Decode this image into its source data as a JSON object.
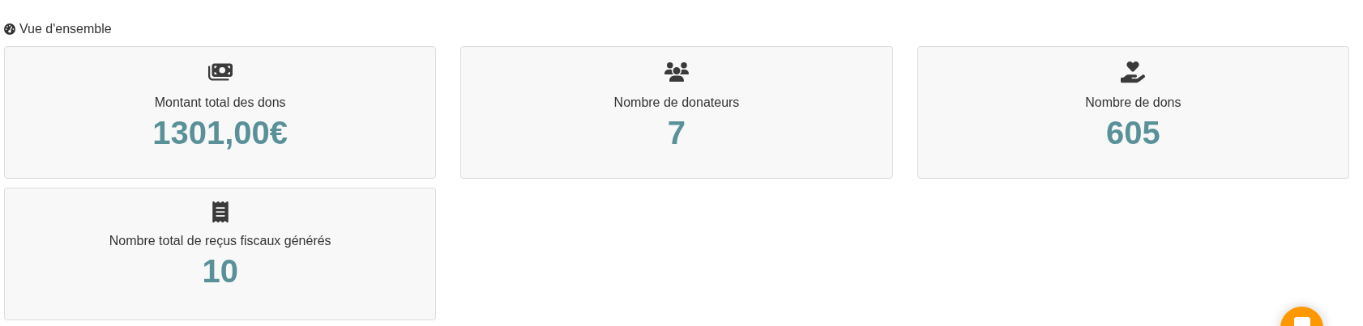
{
  "section": {
    "title": "Vue d'ensemble"
  },
  "stats": [
    {
      "label": "Montant total des dons",
      "value": "1301,00€"
    },
    {
      "label": "Nombre de donateurs",
      "value": "7"
    },
    {
      "label": "Nombre de dons",
      "value": "605"
    },
    {
      "label": "Nombre total de reçus fiscaux générés",
      "value": "10"
    }
  ]
}
